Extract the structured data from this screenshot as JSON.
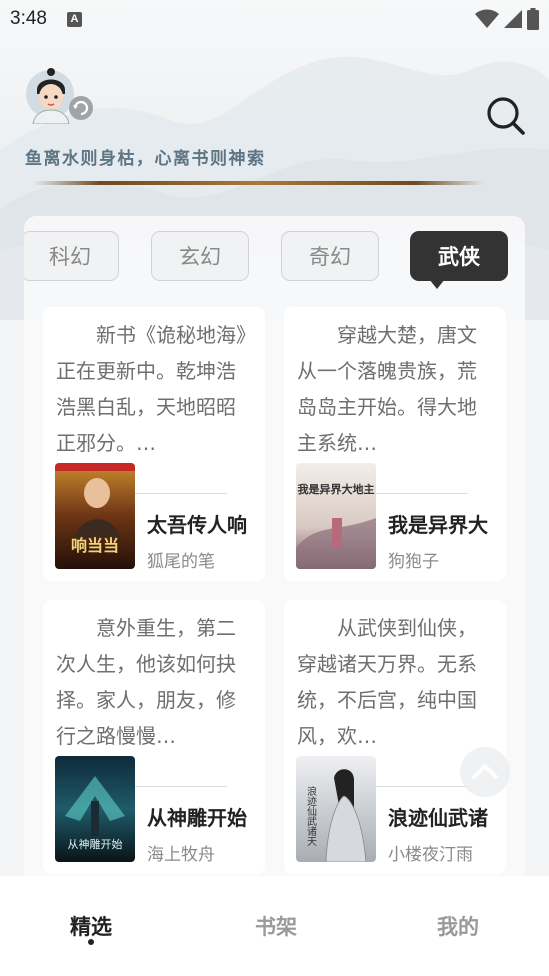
{
  "status_bar": {
    "time": "3:48",
    "notification_icon": "A"
  },
  "header": {
    "slogan": "鱼离水则身枯，心离书则神索"
  },
  "tabs": [
    {
      "label": "科幻",
      "active": false
    },
    {
      "label": "玄幻",
      "active": false
    },
    {
      "label": "奇幻",
      "active": false
    },
    {
      "label": "武侠",
      "active": true
    }
  ],
  "books": [
    {
      "description": "新书《诡秘地海》正在更新中。乾坤浩浩黑白乱，天地昭昭正邪分。…",
      "title": "太吾传人响",
      "author": "狐尾的笔",
      "cover_text": "响当当"
    },
    {
      "description": "穿越大楚，唐文从一个落魄贵族，荒岛岛主开始。得大地主系统…",
      "title": "我是异界大",
      "author": "狗狍子",
      "cover_text": "我是异界大地主"
    },
    {
      "description": "意外重生，第二次人生，他该如何抉择。家人，朋友，修行之路慢慢…",
      "title": "从神雕开始",
      "author": "海上牧舟",
      "cover_text": "从神雕开始"
    },
    {
      "description": "从武侠到仙侠，穿越诸天万界。无系统，不后宫，纯中国风，欢…",
      "title": "浪迹仙武诸",
      "author": "小楼夜汀雨",
      "cover_text": "浪迹仙武诸天"
    }
  ],
  "bottom_nav": [
    {
      "label": "精选",
      "active": true
    },
    {
      "label": "书架",
      "active": false
    },
    {
      "label": "我的",
      "active": false
    }
  ],
  "colors": {
    "accent": "#333333",
    "slogan": "#5d7584",
    "gold": "#a9783a"
  }
}
